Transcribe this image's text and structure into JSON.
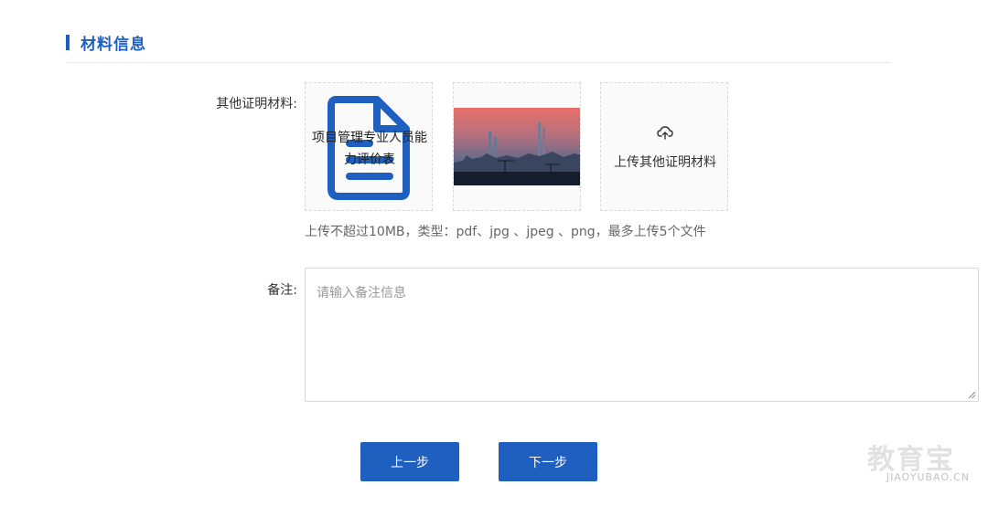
{
  "section": {
    "title": "材料信息"
  },
  "materials": {
    "label": "其他证明材料:",
    "file_card": {
      "name": "项目管理专业人员能力评价表",
      "icon": "document-icon"
    },
    "image_card": {
      "icon": "city-photo"
    },
    "add_card": {
      "label": "上传其他证明材料",
      "icon": "cloud-upload-icon"
    },
    "hint": "上传不超过10MB，类型：pdf、jpg 、jpeg 、png，最多上传5个文件"
  },
  "remark": {
    "label": "备注:",
    "value": "",
    "placeholder": "请输入备注信息"
  },
  "actions": {
    "prev_label": "上一步",
    "next_label": "下一步"
  },
  "watermark": {
    "brand": "教育宝",
    "domain": "JIAOYUBAO.CN"
  },
  "colors": {
    "primary": "#1f5fc0",
    "border": "#d9d9d9",
    "divider": "#ececec"
  }
}
